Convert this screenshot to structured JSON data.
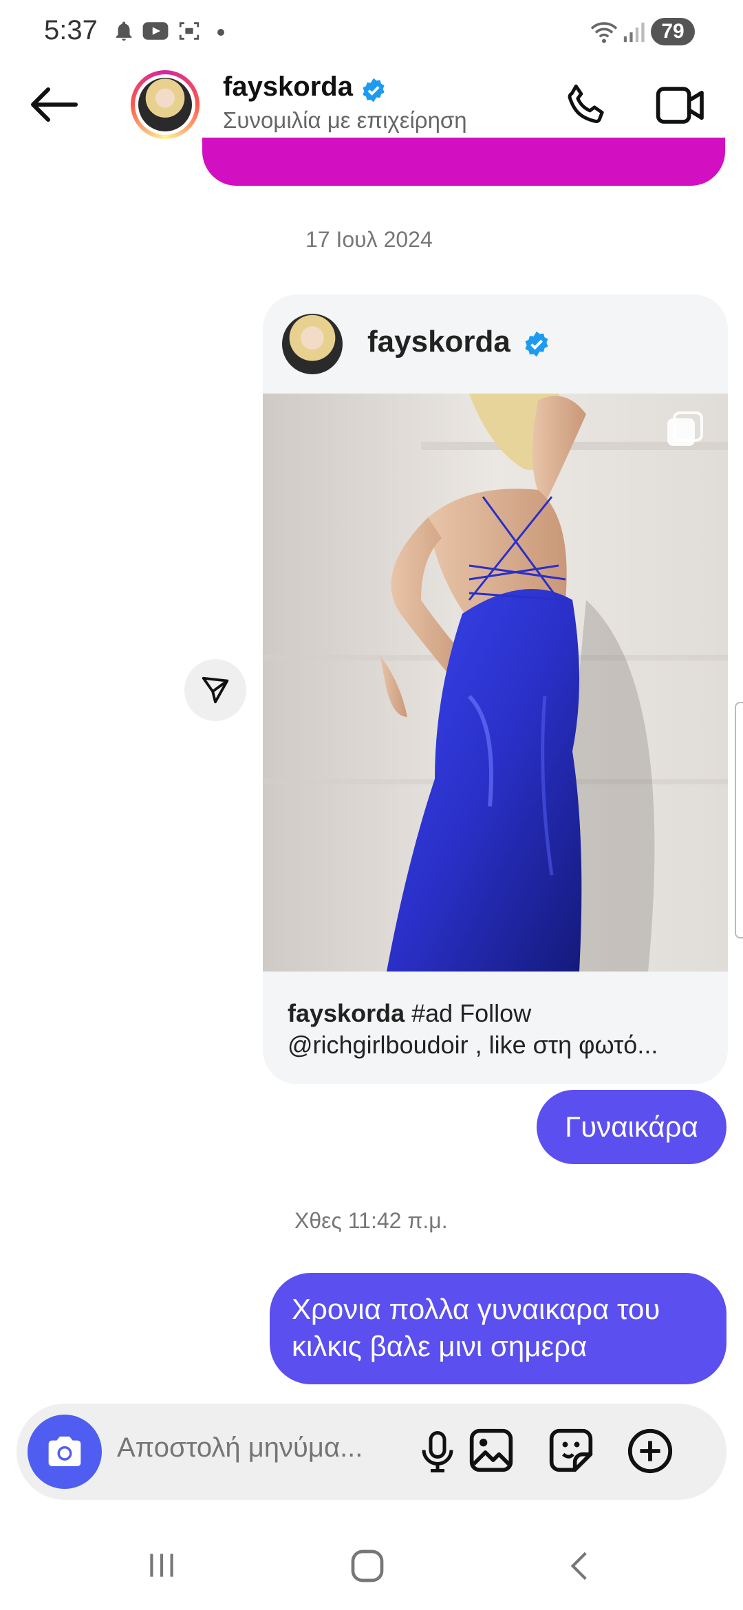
{
  "status_bar": {
    "time": "5:37",
    "battery": "79"
  },
  "header": {
    "name": "fayskorda",
    "subtitle": "Συνομιλία με επιχείρηση"
  },
  "messages": {
    "date_1": "17 Ιουλ 2024",
    "shared_post": {
      "author": "fayskorda",
      "caption_author": "fayskorda",
      "caption_line1": " #ad Follow",
      "caption_line2": "@richgirlboudoir , like στη φωτό..."
    },
    "sent_1": "Γυναικάρα",
    "date_2": "Χθες 11:42 π.μ.",
    "sent_2_line1": "Χρονια πολλα γυναικαρα του",
    "sent_2_line2": "κιλκις βαλε μινι σημερα"
  },
  "composer": {
    "placeholder": "Αποστολή μηνύμα..."
  },
  "colors": {
    "bubble_purple": "#5b4ff0",
    "bubble_magenta": "#d30fc2",
    "verified_blue": "#1d9bf0",
    "dress_blue": "#2a32d8"
  }
}
